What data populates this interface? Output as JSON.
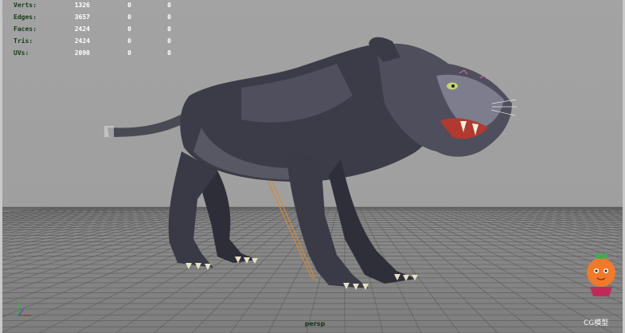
{
  "stats": [
    {
      "label": "Verts:",
      "values": [
        "1326",
        "0",
        "0"
      ]
    },
    {
      "label": "Edges:",
      "values": [
        "3657",
        "0",
        "0"
      ]
    },
    {
      "label": "Faces:",
      "values": [
        "2424",
        "0",
        "0"
      ]
    },
    {
      "label": "Tris:",
      "values": [
        "2424",
        "0",
        "0"
      ]
    },
    {
      "label": "UVs:",
      "values": [
        "2090",
        "0",
        "0"
      ]
    }
  ],
  "camera": "persp",
  "watermark": "CG模型",
  "colors": {
    "viewport_bg": "#a0a0a0",
    "grid_line": "#5a5a5a",
    "hud_label": "#153a15",
    "hud_value": "#ffffff",
    "panther_body": "#3c3c48",
    "skeleton": "#d08a3a"
  },
  "icons": [
    "xyz-axis-icon",
    "fruit-mascot-logo"
  ]
}
